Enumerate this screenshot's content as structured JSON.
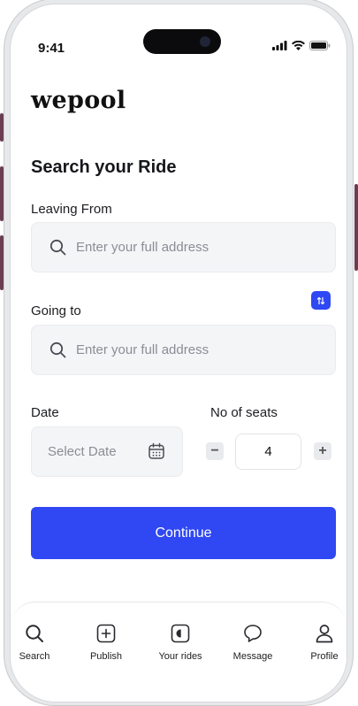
{
  "status_bar": {
    "time": "9:41"
  },
  "app": {
    "logo": "wepool"
  },
  "search": {
    "title": "Search your Ride",
    "leaving_from": {
      "label": "Leaving From",
      "placeholder": "Enter your full address"
    },
    "going_to": {
      "label": "Going to",
      "placeholder": "Enter your full address"
    },
    "date": {
      "label": "Date",
      "placeholder": "Select Date"
    },
    "seats": {
      "label": "No of seats",
      "value": "4",
      "minus": "−",
      "plus": "+"
    },
    "continue_label": "Continue"
  },
  "nav": {
    "items": [
      {
        "label": "Search",
        "icon": "search-icon"
      },
      {
        "label": "Publish",
        "icon": "plus-square-icon"
      },
      {
        "label": "Your rides",
        "icon": "rides-icon"
      },
      {
        "label": "Message",
        "icon": "message-icon"
      },
      {
        "label": "Profile",
        "icon": "profile-icon"
      }
    ]
  },
  "colors": {
    "accent": "#2f48f3",
    "field_bg": "#f4f5f7"
  }
}
